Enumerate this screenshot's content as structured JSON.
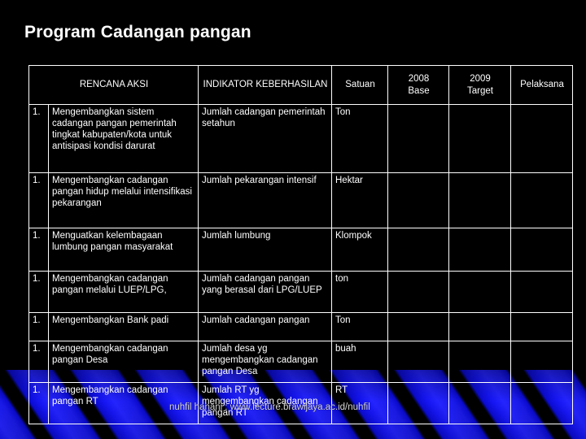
{
  "slide": {
    "title": "Program Cadangan pangan",
    "footer": "nuhfil hanani : www.lecture.brawijaya.ac.id/nuhfil",
    "background_color": "#000000",
    "text_color": "#ffffff",
    "accent_color": "#1b1bf0"
  },
  "table": {
    "headers": {
      "no": "",
      "rencana_aksi": "RENCANA AKSI",
      "indikator": "INDIKATOR KEBERHASILAN",
      "satuan": "Satuan",
      "base": "2008 Base",
      "base_line1": "2008",
      "base_line2": "Base",
      "target_line1": "2009",
      "target_line2": "Target",
      "target": "2009 Target",
      "pelaksana": "Pelaksana"
    },
    "rows": [
      {
        "no": "1.",
        "rencana_aksi": "Mengembangkan sistem cadangan pangan pemerintah tingkat kabupaten/kota untuk antisipasi kondisi darurat",
        "indikator": "Jumlah  cadangan pemerintah setahun",
        "satuan": "Ton",
        "base": "",
        "target": "",
        "pelaksana": ""
      },
      {
        "no": "1.",
        "rencana_aksi": "Mengembangkan cadangan pangan hidup melalui intensifikasi pekarangan",
        "indikator": "Jumlah  pekarangan intensif",
        "satuan": "Hektar",
        "base": "",
        "target": "",
        "pelaksana": ""
      },
      {
        "no": "1.",
        "rencana_aksi": "Menguatkan kelembagaan lumbung pangan masyarakat",
        "indikator": "Jumlah lumbung",
        "satuan": "Klompok",
        "base": "",
        "target": "",
        "pelaksana": ""
      },
      {
        "no": "1.",
        "rencana_aksi": "Mengembangkan cadangan pangan melalui LUEP/LPG,",
        "indikator": "Jumlah cadangan pangan yang berasal dari LPG/LUEP",
        "satuan": "ton",
        "base": "",
        "target": "",
        "pelaksana": ""
      },
      {
        "no": "1.",
        "rencana_aksi": "Mengembangkan Bank padi",
        "indikator": "Jumlah cadangan pangan",
        "satuan": "Ton",
        "base": "",
        "target": "",
        "pelaksana": ""
      },
      {
        "no": "1.",
        "rencana_aksi": "Mengembangkan cadangan pangan Desa",
        "indikator": "Jumlah desa yg mengembangkan cadangan pangan Desa",
        "satuan": "buah",
        "base": "",
        "target": "",
        "pelaksana": ""
      },
      {
        "no": "1.",
        "rencana_aksi": "Mengembangkan cadangan pangan RT",
        "indikator": "Jumlah RT yg mengembangkan cadangan pangan RT",
        "satuan": "RT",
        "base": "",
        "target": "",
        "pelaksana": ""
      }
    ]
  }
}
